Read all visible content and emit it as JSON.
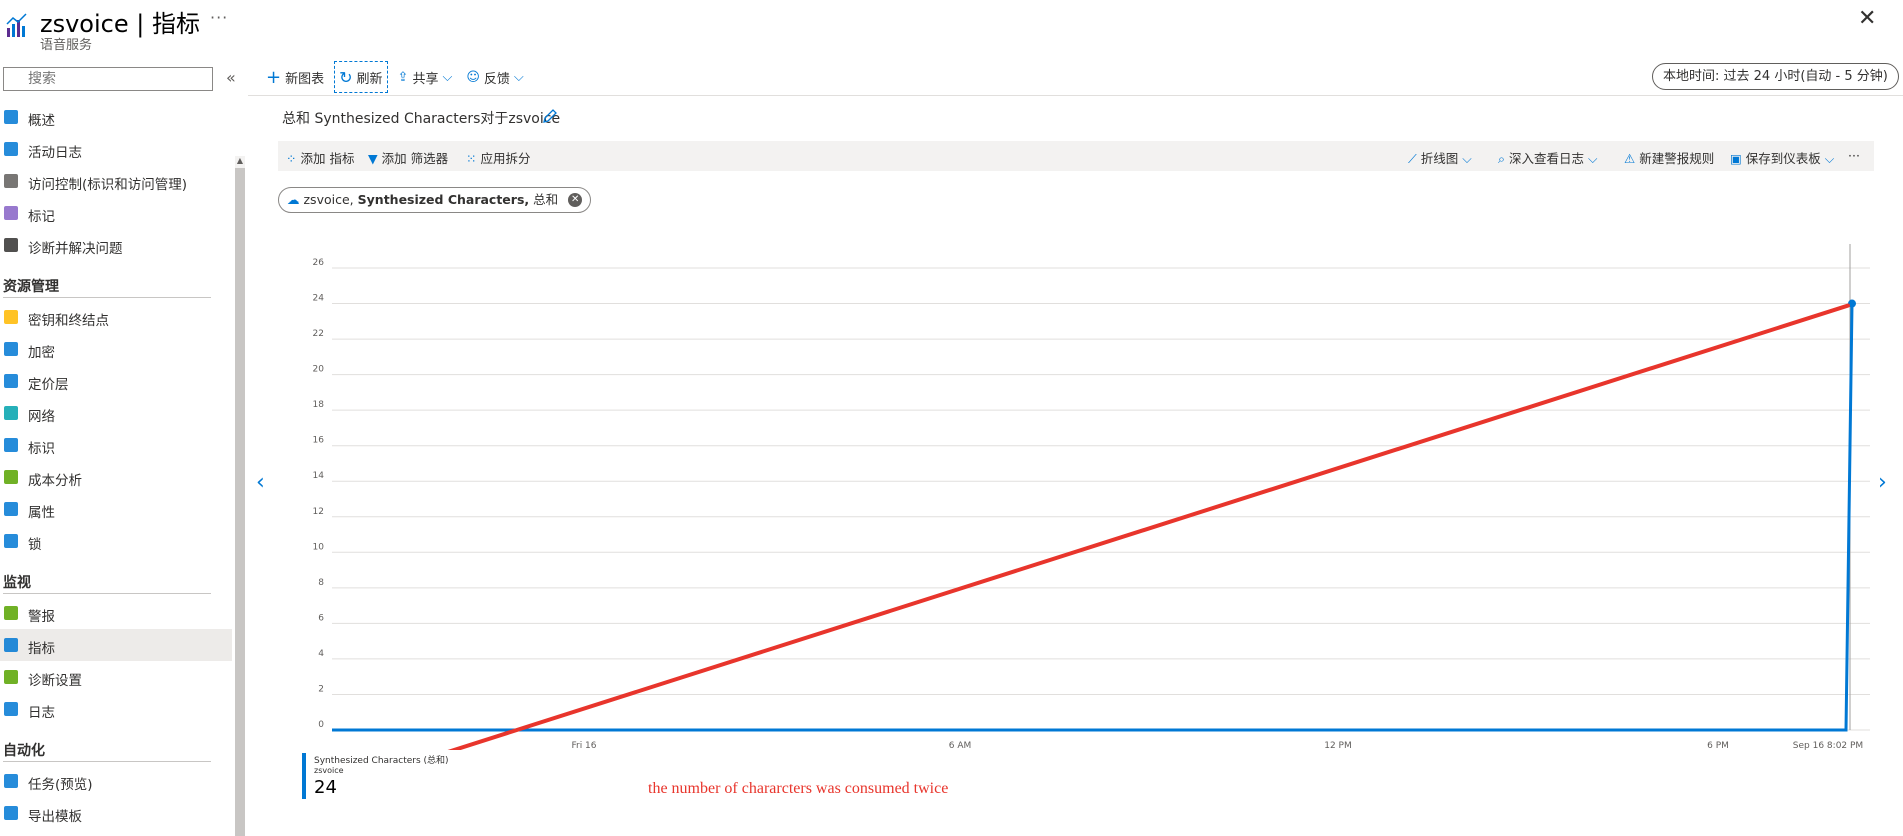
{
  "header": {
    "title": "zsvoice | 指标",
    "subtitle": "语音服务",
    "more": "···",
    "close": "✕"
  },
  "sidebar": {
    "search_placeholder": "搜索",
    "collapse": "«",
    "items_top": [
      {
        "label": "概述",
        "icon": "overview-icon"
      },
      {
        "label": "活动日志",
        "icon": "activity-log-icon"
      },
      {
        "label": "访问控制(标识和访问管理)",
        "icon": "iam-icon"
      },
      {
        "label": "标记",
        "icon": "tag-icon"
      },
      {
        "label": "诊断并解决问题",
        "icon": "wrench-icon"
      }
    ],
    "section_resource": "资源管理",
    "items_resource": [
      {
        "label": "密钥和终结点",
        "icon": "key-icon"
      },
      {
        "label": "加密",
        "icon": "lock-icon"
      },
      {
        "label": "定价层",
        "icon": "pricing-icon"
      },
      {
        "label": "网络",
        "icon": "network-icon"
      },
      {
        "label": "标识",
        "icon": "identity-icon"
      },
      {
        "label": "成本分析",
        "icon": "cost-icon"
      },
      {
        "label": "属性",
        "icon": "properties-icon"
      },
      {
        "label": "锁",
        "icon": "lock-icon"
      }
    ],
    "section_monitor": "监视",
    "items_monitor": [
      {
        "label": "警报",
        "icon": "alert-icon"
      },
      {
        "label": "指标",
        "icon": "metrics-icon",
        "active": true
      },
      {
        "label": "诊断设置",
        "icon": "diag-settings-icon"
      },
      {
        "label": "日志",
        "icon": "logs-icon"
      }
    ],
    "section_auto": "自动化",
    "items_auto": [
      {
        "label": "任务(预览)",
        "icon": "tasks-icon"
      },
      {
        "label": "导出模板",
        "icon": "export-template-icon"
      }
    ]
  },
  "toolbar": {
    "new_chart": "新图表",
    "refresh": "刷新",
    "share": "共享",
    "feedback": "反馈",
    "time_range": "本地时间: 过去 24 小时(自动 - 5 分钟)"
  },
  "chart_header": {
    "title": "总和 Synthesized Characters对于zsvoice",
    "add_metric": "添加 指标",
    "add_filter": "添加 筛选器",
    "apply_split": "应用拆分",
    "line_chart": "折线图",
    "drill_logs": "深入查看日志",
    "new_alert": "新建警报规则",
    "save_dashboard": "保存到仪表板",
    "more": "···"
  },
  "metric_pill": {
    "resource": "zsvoice,",
    "metric": "Synthesized Characters,",
    "aggregation": "总和"
  },
  "legend": {
    "name": "Synthesized Characters (总和)",
    "resource": "zsvoice",
    "value": "24"
  },
  "annotation": "the number of chararcters was consumed twice",
  "colors": {
    "accent": "#0078d4",
    "annotation": "#e8352c"
  },
  "chart_data": {
    "type": "line",
    "title": "",
    "xlabel": "",
    "ylabel": "",
    "ylim": [
      0,
      26
    ],
    "y_ticks": [
      0,
      2,
      4,
      6,
      8,
      10,
      12,
      14,
      16,
      18,
      20,
      22,
      24,
      26
    ],
    "x_tick_labels": [
      "Fri 16",
      "6 AM",
      "12 PM",
      "6 PM",
      "Sep 16 8:02 PM"
    ],
    "series": [
      {
        "name": "Synthesized Characters (总和)",
        "x": [
          "start",
          "Sep 16 8:00 PM",
          "Sep 16 8:02 PM"
        ],
        "values": [
          0,
          0,
          24
        ]
      }
    ],
    "grid": true
  }
}
